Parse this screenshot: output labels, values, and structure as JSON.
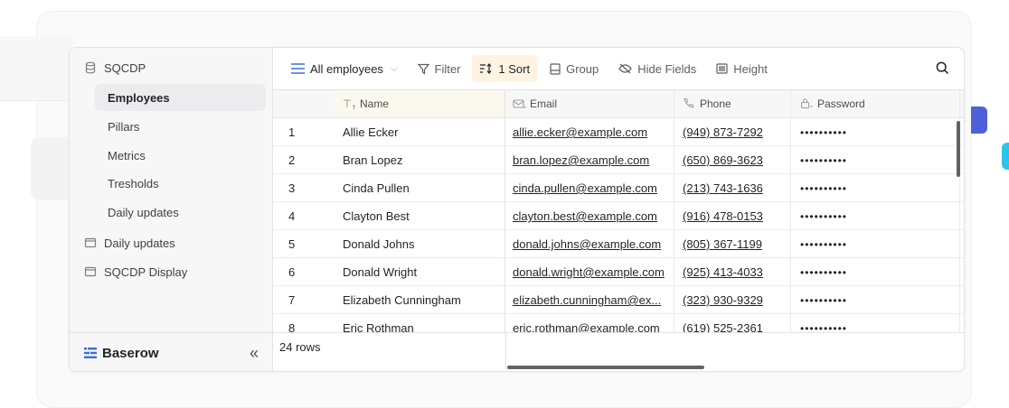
{
  "sidebar": {
    "database_name": "SQCDP",
    "tables": [
      {
        "label": "Employees",
        "active": true
      },
      {
        "label": "Pillars",
        "active": false
      },
      {
        "label": "Metrics",
        "active": false
      },
      {
        "label": "Tresholds",
        "active": false
      },
      {
        "label": "Daily updates",
        "active": false
      }
    ],
    "apps": [
      {
        "label": "Daily updates",
        "icon": "application-icon"
      },
      {
        "label": "SQCDP Display",
        "icon": "application-icon"
      }
    ],
    "logo_text": "Baserow",
    "collapse_glyph": "«"
  },
  "toolbar": {
    "view_label": "All employees",
    "filter_label": "Filter",
    "sort_label": "1 Sort",
    "group_label": "Group",
    "hide_fields_label": "Hide Fields",
    "height_label": "Height",
    "accent_sort_bg": "#fff4e2"
  },
  "grid": {
    "columns": [
      {
        "label": "Name",
        "icon": "text-field-icon"
      },
      {
        "label": "Email",
        "icon": "email-field-icon"
      },
      {
        "label": "Phone",
        "icon": "phone-field-icon"
      },
      {
        "label": "Password",
        "icon": "password-field-icon"
      }
    ],
    "rows": [
      {
        "id": "1",
        "name": "Allie Ecker",
        "email": "allie.ecker@example.com",
        "phone": "(949) 873-7292",
        "password": "••••••••••"
      },
      {
        "id": "2",
        "name": "Bran Lopez",
        "email": "bran.lopez@example.com",
        "phone": "(650) 869-3623",
        "password": "••••••••••"
      },
      {
        "id": "3",
        "name": "Cinda Pullen",
        "email": "cinda.pullen@example.com",
        "phone": "(213) 743-1636",
        "password": "••••••••••"
      },
      {
        "id": "4",
        "name": "Clayton Best",
        "email": "clayton.best@example.com",
        "phone": "(916) 478-0153",
        "password": "••••••••••"
      },
      {
        "id": "5",
        "name": "Donald Johns",
        "email": "donald.johns@example.com",
        "phone": "(805) 367-1199",
        "password": "••••••••••"
      },
      {
        "id": "6",
        "name": "Donald Wright",
        "email": "donald.wright@example.com",
        "phone": "(925) 413-4033",
        "password": "••••••••••"
      },
      {
        "id": "7",
        "name": "Elizabeth Cunningham",
        "email": "elizabeth.cunningham@ex...",
        "phone": "(323) 930-9329",
        "password": "••••••••••"
      },
      {
        "id": "8",
        "name": "Eric Rothman",
        "email": "eric.rothman@example.com",
        "phone": "(619) 525-2361",
        "password": "••••••••••"
      }
    ],
    "row_count_label": "24 rows"
  },
  "colors": {
    "accent_blue": "#4f5fd9",
    "accent_cyan": "#2cc5e8",
    "logo_blue": "#3d6ce0"
  }
}
